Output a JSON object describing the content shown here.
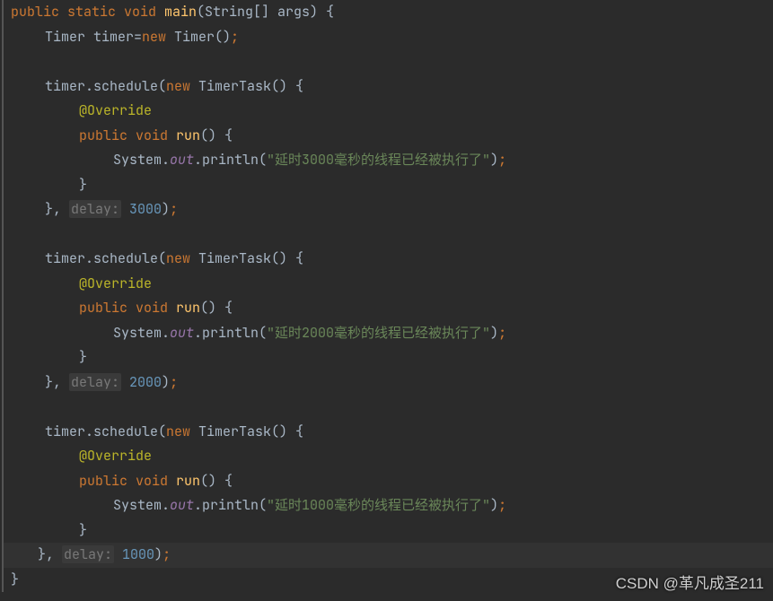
{
  "code": {
    "method_sig": {
      "kw1": "public static void ",
      "method": "main",
      "params": "(String[] args) {"
    },
    "timer_decl": {
      "text1": "Timer timer=",
      "kw_new": "new ",
      "text2": "Timer()",
      "semi": ";"
    },
    "block1": {
      "schedule_open": {
        "text1": "timer.schedule(",
        "kw_new": "new ",
        "text2": "TimerTask() {"
      },
      "override": "@Override",
      "run_sig": {
        "kw1": "public void ",
        "method": "run",
        "rest": "() {"
      },
      "println": {
        "sys": "System.",
        "out": "out",
        "print": ".println(",
        "str": "\"延时3000毫秒的线程已经被执行了\"",
        "close": ")",
        "semi": ";"
      },
      "close_brace": "}",
      "schedule_close": {
        "brace": "}, ",
        "hint": "delay:",
        "num": " 3000",
        "close": ")",
        "semi": ";"
      }
    },
    "block2": {
      "schedule_open": {
        "text1": "timer.schedule(",
        "kw_new": "new ",
        "text2": "TimerTask() {"
      },
      "override": "@Override",
      "run_sig": {
        "kw1": "public void ",
        "method": "run",
        "rest": "() {"
      },
      "println": {
        "sys": "System.",
        "out": "out",
        "print": ".println(",
        "str": "\"延时2000毫秒的线程已经被执行了\"",
        "close": ")",
        "semi": ";"
      },
      "close_brace": "}",
      "schedule_close": {
        "brace": "}, ",
        "hint": "delay:",
        "num": " 2000",
        "close": ")",
        "semi": ";"
      }
    },
    "block3": {
      "schedule_open": {
        "text1": "timer.schedule(",
        "kw_new": "new ",
        "text2": "TimerTask() {"
      },
      "override": "@Override",
      "run_sig": {
        "kw1": "public void ",
        "method": "run",
        "rest": "() {"
      },
      "println": {
        "sys": "System.",
        "out": "out",
        "print": ".println(",
        "str": "\"延时1000毫秒的线程已经被执行了\"",
        "close": ")",
        "semi": ";"
      },
      "close_brace": "}",
      "schedule_close": {
        "brace": "}, ",
        "hint": "delay:",
        "num": " 1000",
        "close": ")",
        "semi": ";"
      }
    },
    "method_close": "}"
  },
  "watermark": "CSDN @革凡成圣211"
}
